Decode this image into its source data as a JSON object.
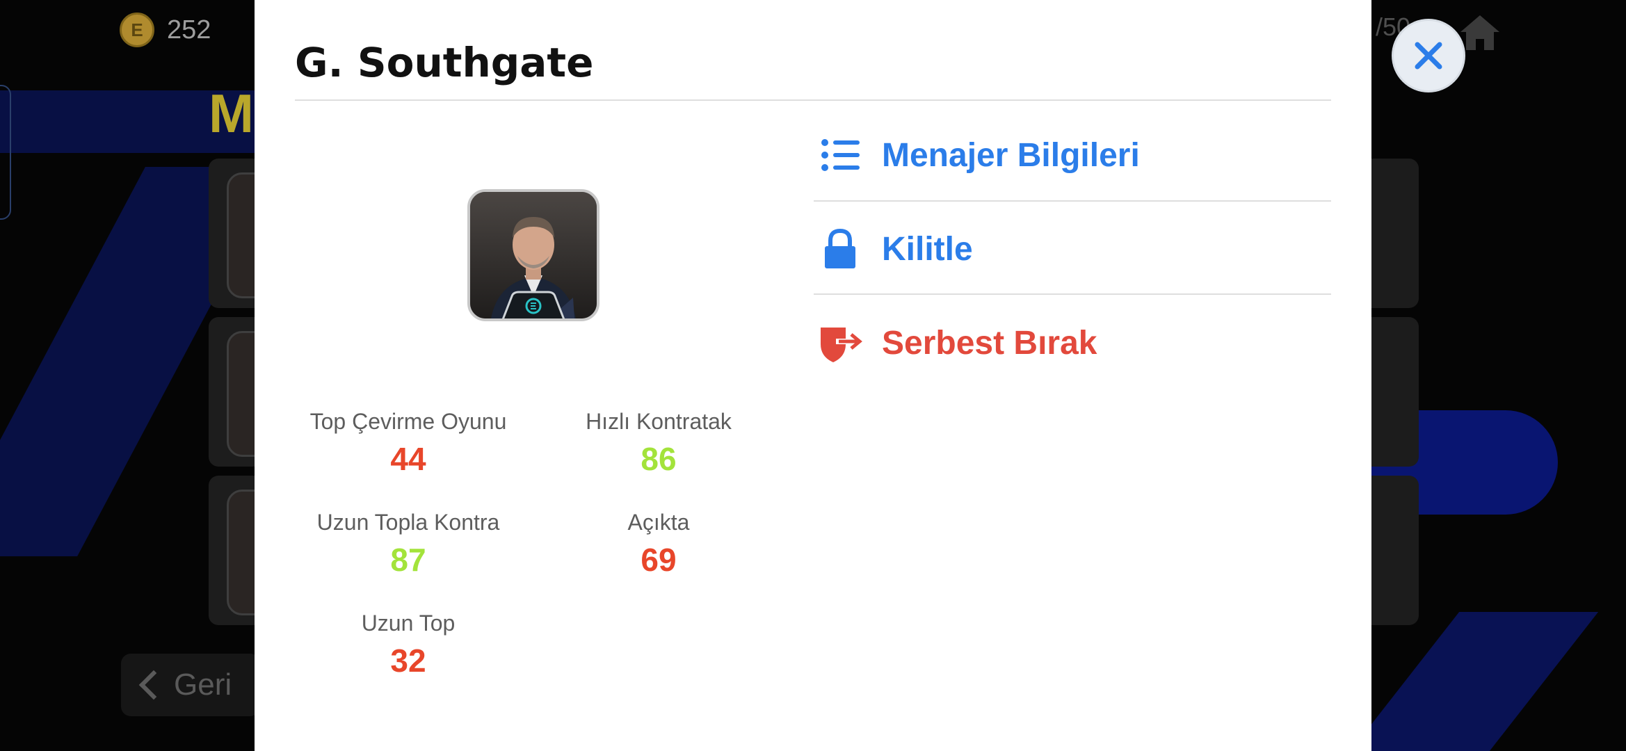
{
  "background": {
    "currency_value": "252",
    "menu_title_initial": "M",
    "back_label": "Geri",
    "page_counter": "/50"
  },
  "modal": {
    "title": "G. Southgate",
    "manager_badge_icon": "efootball-badge-icon",
    "stats": [
      {
        "label": "Top Çevirme Oyunu",
        "value": "44",
        "color": "#e8462a"
      },
      {
        "label": "Hızlı Kontratak",
        "value": "86",
        "color": "#a3e33b"
      },
      {
        "label": "Uzun Topla Kontra",
        "value": "87",
        "color": "#a3e33b"
      },
      {
        "label": "Açıkta",
        "value": "69",
        "color": "#e8462a"
      },
      {
        "label": "Uzun Top",
        "value": "32",
        "color": "#e8462a"
      }
    ],
    "actions": [
      {
        "label": "Menajer Bilgileri",
        "icon": "list-icon",
        "color": "#2b7de9"
      },
      {
        "label": "Kilitle",
        "icon": "lock-icon",
        "color": "#2b7de9"
      },
      {
        "label": "Serbest Bırak",
        "icon": "release-icon",
        "color": "#e2493c"
      }
    ],
    "close_icon": "close-icon"
  },
  "colors": {
    "accent_blue": "#2b7de9",
    "release_red": "#e2493c",
    "stat_low": "#e8462a",
    "stat_high": "#a3e33b"
  }
}
